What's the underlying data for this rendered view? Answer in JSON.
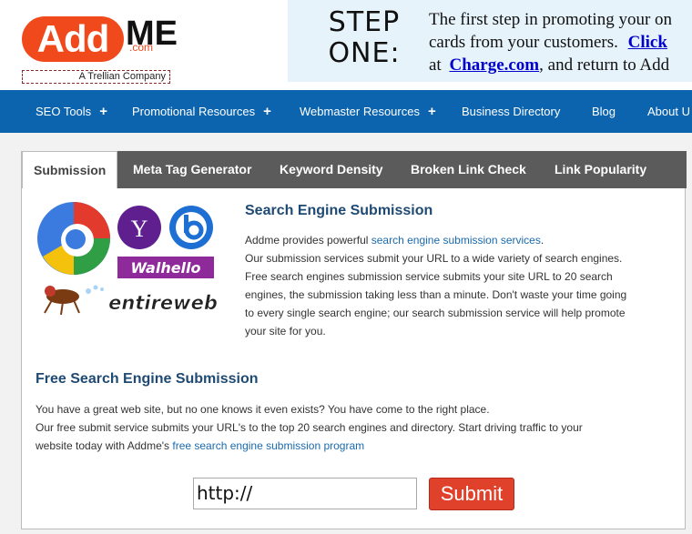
{
  "header": {
    "logo_add": "Add",
    "logo_me": "ME",
    "logo_dotcom": ".com",
    "tagline": "A Trellian Company",
    "brand_color": "#f04a1c"
  },
  "banner": {
    "step_line1": "STEP",
    "step_line2": "ONE:",
    "text_line1": "The first step in promoting your on",
    "text_line2_pre": "cards from your customers.",
    "text_line2_link": "Click",
    "text_line3_pre": "at",
    "text_line3_link": "Charge.com",
    "text_line3_post": ", and return to Add"
  },
  "nav": {
    "items": [
      {
        "label": "SEO Tools",
        "plus": "+"
      },
      {
        "label": "Promotional Resources",
        "plus": "+"
      },
      {
        "label": "Webmaster Resources",
        "plus": "+"
      },
      {
        "label": "Business Directory",
        "plus": ""
      },
      {
        "label": "Blog",
        "plus": ""
      },
      {
        "label": "About U",
        "plus": ""
      }
    ],
    "bg_color": "#0b64ad"
  },
  "tabs": [
    {
      "label": "Submission",
      "active": true
    },
    {
      "label": "Meta Tag Generator",
      "active": false
    },
    {
      "label": "Keyword Density",
      "active": false
    },
    {
      "label": "Broken Link Check",
      "active": false
    },
    {
      "label": "Link Popularity",
      "active": false
    }
  ],
  "engine_logos": {
    "yahoo_letter": "Y",
    "walhello": "Walhello",
    "entireweb": "entireweb"
  },
  "section1": {
    "title": "Search Engine Submission",
    "p1_pre": "Addme provides powerful ",
    "p1_link": "search engine submission services",
    "p1_post": ".",
    "p2": "Our submission services submit your URL to a wide variety of search engines.",
    "p3": "Free search engines submission service submits your site URL to 20 search",
    "p4": "engines, the submission taking less than a minute. Don't waste your time going",
    "p5": "to every single search engine; our search submission service will help promote",
    "p6": "your site for you."
  },
  "section2": {
    "title": "Free Search Engine Submission",
    "l1": "You have a great web site, but no one knows it even exists? You have come to the right place.",
    "l2": "Our free submit service submits your URL's to the top 20 search engines and directory. Start driving traffic to your",
    "l3_pre": "website today with Addme's ",
    "l3_link": "free search engine submission program"
  },
  "form": {
    "url_value": "http://",
    "submit_label": "Submit"
  }
}
